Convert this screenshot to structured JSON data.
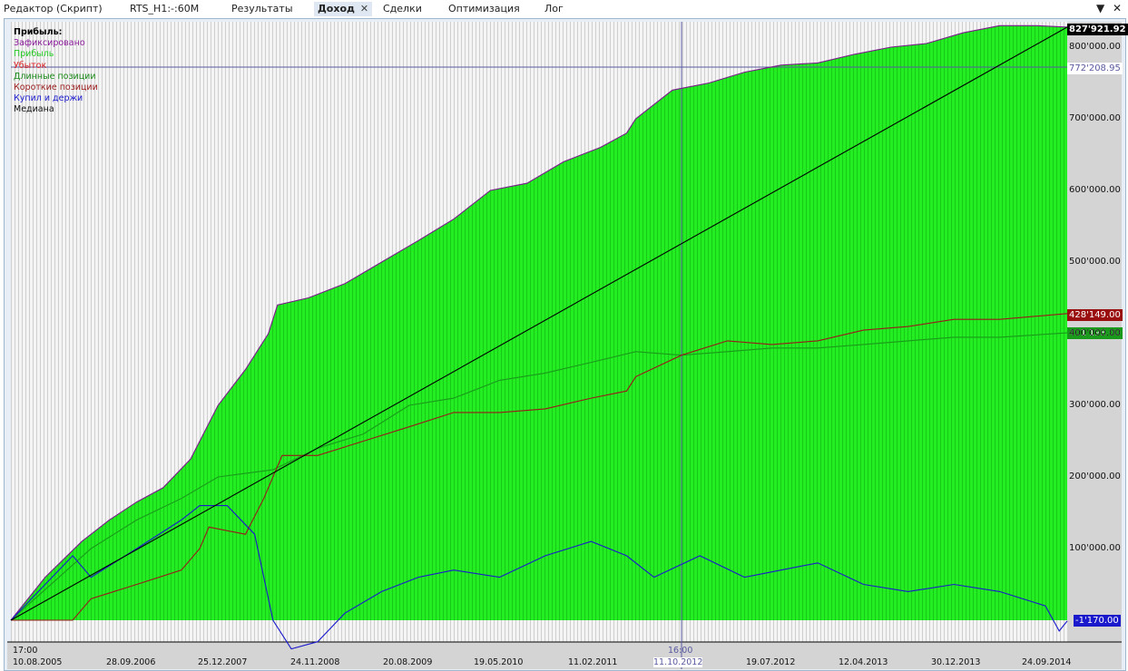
{
  "tabs": [
    {
      "label": "Редактор (Скрипт)"
    },
    {
      "label": "RTS_H1:-:60M"
    },
    {
      "label": "Результаты"
    },
    {
      "label": "Доход",
      "active": true
    },
    {
      "label": "Сделки"
    },
    {
      "label": "Оптимизация"
    },
    {
      "label": "Лог"
    }
  ],
  "legend": {
    "title": "Прибыль:",
    "items": [
      {
        "label": "Зафиксировано",
        "color": "#8a1a9a"
      },
      {
        "label": "Прибыль",
        "color": "#22cc22"
      },
      {
        "label": "Убыток",
        "color": "#dd2222"
      },
      {
        "label": "Длинные позиции",
        "color": "#1a8a1a"
      },
      {
        "label": "Короткие позиции",
        "color": "#9a1a1a"
      },
      {
        "label": "Купил и держи",
        "color": "#1a1acc"
      },
      {
        "label": "Медиана",
        "color": "#111111"
      }
    ]
  },
  "axis": {
    "y_ticks": [
      "800'000.00",
      "700'000.00",
      "600'000.00",
      "500'000.00",
      "400'000.00",
      "300'000.00",
      "200'000.00",
      "100'000.00"
    ],
    "time_label": "17:00",
    "x_ticks": [
      "10.08.2005",
      "28.09.2006",
      "25.12.2007",
      "24.11.2008",
      "20.08.2009",
      "19.05.2010",
      "11.02.2011",
      "19.07.2012",
      "12.04.2013",
      "30.12.2013",
      "24.09.2014"
    ],
    "cursor_time": "16:00",
    "cursor_date": "11.10.2012"
  },
  "markers": {
    "profit": "827'921.92",
    "cursor": "772'208.95",
    "short": "428'149.00",
    "long": "401'198.00",
    "buyhold": "-1'170.00"
  },
  "chart_data": {
    "type": "area",
    "ylim": [
      -60000,
      860000
    ],
    "xlim": [
      2005.61,
      2014.84
    ],
    "xlabel": "",
    "ylabel": "Прибыль",
    "cursor_value": 772208.95,
    "cursor_x": 2011.47,
    "series": [
      {
        "name": "Зафиксировано",
        "x": [
          2005.61,
          2005.91,
          2006.23,
          2006.47,
          2006.71,
          2006.94,
          2007.18,
          2007.42,
          2007.66,
          2007.86,
          2007.94,
          2008.21,
          2008.53,
          2008.85,
          2009.17,
          2009.48,
          2009.8,
          2010.12,
          2010.44,
          2010.76,
          2010.99,
          2011.07,
          2011.39,
          2011.71,
          2012.02,
          2012.34,
          2012.66,
          2012.98,
          2013.3,
          2013.61,
          2013.93,
          2014.25,
          2014.57,
          2014.84
        ],
        "y": [
          0,
          60000,
          110000,
          140000,
          165000,
          185000,
          225000,
          300000,
          350000,
          400000,
          440000,
          450000,
          470000,
          500000,
          530000,
          560000,
          600000,
          610000,
          640000,
          660000,
          680000,
          700000,
          740000,
          750000,
          765000,
          775000,
          778000,
          790000,
          800000,
          805000,
          820000,
          830000,
          830000,
          827921.92
        ]
      },
      {
        "name": "Длинные позиции",
        "x": [
          2005.61,
          2006.31,
          2006.71,
          2007.1,
          2007.42,
          2007.9,
          2008.29,
          2008.69,
          2009.09,
          2009.48,
          2009.88,
          2010.28,
          2010.68,
          2011.07,
          2011.47,
          2011.87,
          2012.26,
          2012.66,
          2013.06,
          2013.45,
          2013.85,
          2014.25,
          2014.84
        ],
        "y": [
          0,
          100000,
          140000,
          170000,
          200000,
          210000,
          240000,
          260000,
          300000,
          310000,
          335000,
          345000,
          360000,
          375000,
          370000,
          375000,
          380000,
          380000,
          385000,
          390000,
          395000,
          395000,
          401198
        ]
      },
      {
        "name": "Короткие позиции",
        "x": [
          2005.61,
          2006.15,
          2006.31,
          2006.71,
          2007.1,
          2007.26,
          2007.34,
          2007.66,
          2007.82,
          2007.98,
          2008.29,
          2008.69,
          2009.09,
          2009.48,
          2009.88,
          2010.28,
          2010.68,
          2010.99,
          2011.07,
          2011.47,
          2011.87,
          2012.26,
          2012.66,
          2013.06,
          2013.45,
          2013.85,
          2014.25,
          2014.84
        ],
        "y": [
          0,
          0,
          30000,
          50000,
          70000,
          100000,
          130000,
          120000,
          170000,
          230000,
          230000,
          250000,
          270000,
          290000,
          290000,
          295000,
          310000,
          320000,
          340000,
          370000,
          390000,
          385000,
          390000,
          405000,
          410000,
          420000,
          420000,
          428149
        ]
      },
      {
        "name": "Купил и держи",
        "x": [
          2005.61,
          2005.91,
          2006.15,
          2006.31,
          2006.71,
          2007.1,
          2007.26,
          2007.5,
          2007.74,
          2007.9,
          2008.06,
          2008.29,
          2008.53,
          2008.85,
          2009.17,
          2009.48,
          2009.88,
          2010.28,
          2010.68,
          2010.99,
          2011.23,
          2011.63,
          2012.02,
          2012.34,
          2012.66,
          2013.06,
          2013.45,
          2013.85,
          2014.25,
          2014.65,
          2014.77,
          2014.84
        ],
        "y": [
          0,
          50000,
          90000,
          60000,
          100000,
          140000,
          160000,
          160000,
          120000,
          0,
          -40000,
          -30000,
          10000,
          40000,
          60000,
          70000,
          60000,
          90000,
          110000,
          90000,
          60000,
          90000,
          60000,
          70000,
          80000,
          50000,
          40000,
          50000,
          40000,
          20000,
          -15000,
          -1170
        ]
      },
      {
        "name": "Медиана",
        "x": [
          2005.61,
          2014.84
        ],
        "y": [
          0,
          827921.92
        ]
      }
    ]
  }
}
